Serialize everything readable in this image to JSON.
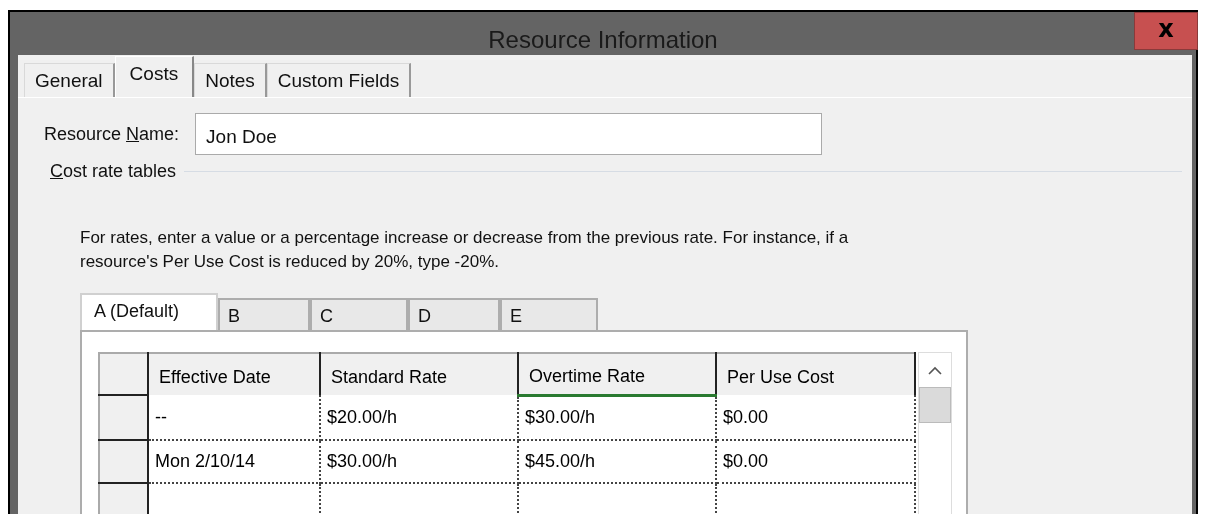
{
  "window": {
    "title": "Resource Information",
    "close": "x"
  },
  "tabs": [
    {
      "label": "General",
      "selected": false
    },
    {
      "label": "Costs",
      "selected": true
    },
    {
      "label": "Notes",
      "selected": false
    },
    {
      "label": "Custom Fields",
      "selected": false
    }
  ],
  "resource_name": {
    "label": {
      "before": "Resource ",
      "access_key": "N",
      "after": "ame:"
    },
    "value": "Jon Doe"
  },
  "group": {
    "label": {
      "access_key": "C",
      "after": "ost rate tables"
    }
  },
  "instructions": "For rates, enter a value or a percentage increase or decrease from the previous rate. For instance, if a resource's Per Use Cost is reduced by 20%, type -20%.",
  "rate_tabs": [
    {
      "label": "A (Default)",
      "selected": true
    },
    {
      "label": "B",
      "selected": false
    },
    {
      "label": "C",
      "selected": false
    },
    {
      "label": "D",
      "selected": false
    },
    {
      "label": "E",
      "selected": false
    }
  ],
  "table": {
    "columns": [
      {
        "label": "Effective Date",
        "selected": false
      },
      {
        "label": "Standard Rate",
        "selected": false
      },
      {
        "label": "Overtime Rate",
        "selected": true
      },
      {
        "label": "Per Use Cost",
        "selected": false
      }
    ],
    "rows": [
      [
        "--",
        "$20.00/h",
        "$30.00/h",
        "$0.00"
      ],
      [
        "Mon 2/10/14",
        "$30.00/h",
        "$45.00/h",
        "$0.00"
      ]
    ]
  }
}
